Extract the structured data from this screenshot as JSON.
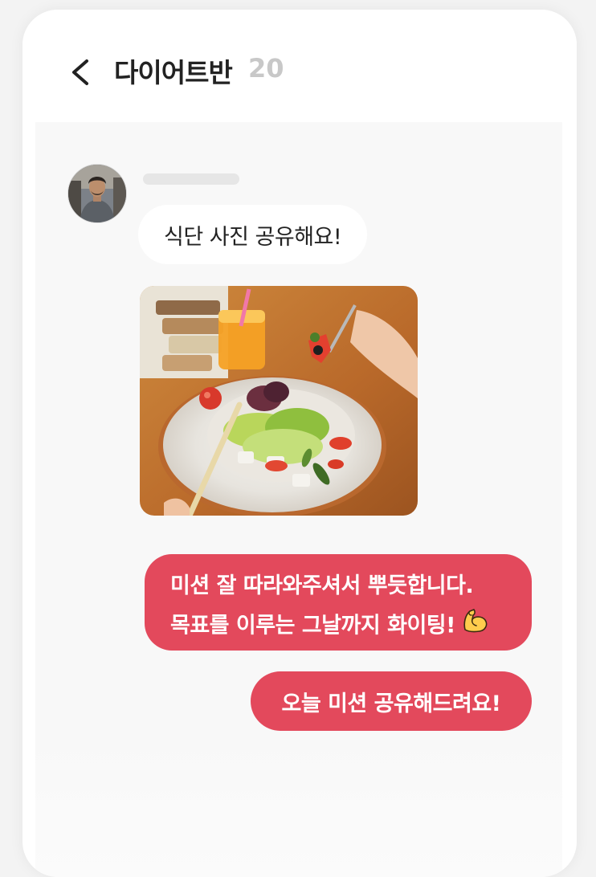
{
  "header": {
    "back_icon": "chevron-left-icon",
    "title": "다이어트반",
    "member_count": "20"
  },
  "chat": {
    "incoming": {
      "avatar_icon": "user-avatar",
      "message": "식단 사진 공유해요!",
      "photo_icon": "salad-photo"
    },
    "outgoing": [
      {
        "line1": "미션 잘 따라와주셔서 뿌듯합니다.",
        "line2": "목표를 이루는 그날까지 화이팅!",
        "emoji_icon": "flexed-biceps-icon"
      },
      {
        "line1": "오늘 미션 공유해드려요!"
      }
    ]
  },
  "colors": {
    "accent": "#e3495c",
    "chat_background": "#f8f8f8",
    "incoming_bubble": "#ffffff",
    "title_text": "#222222",
    "count_text": "#c8c8c8"
  }
}
